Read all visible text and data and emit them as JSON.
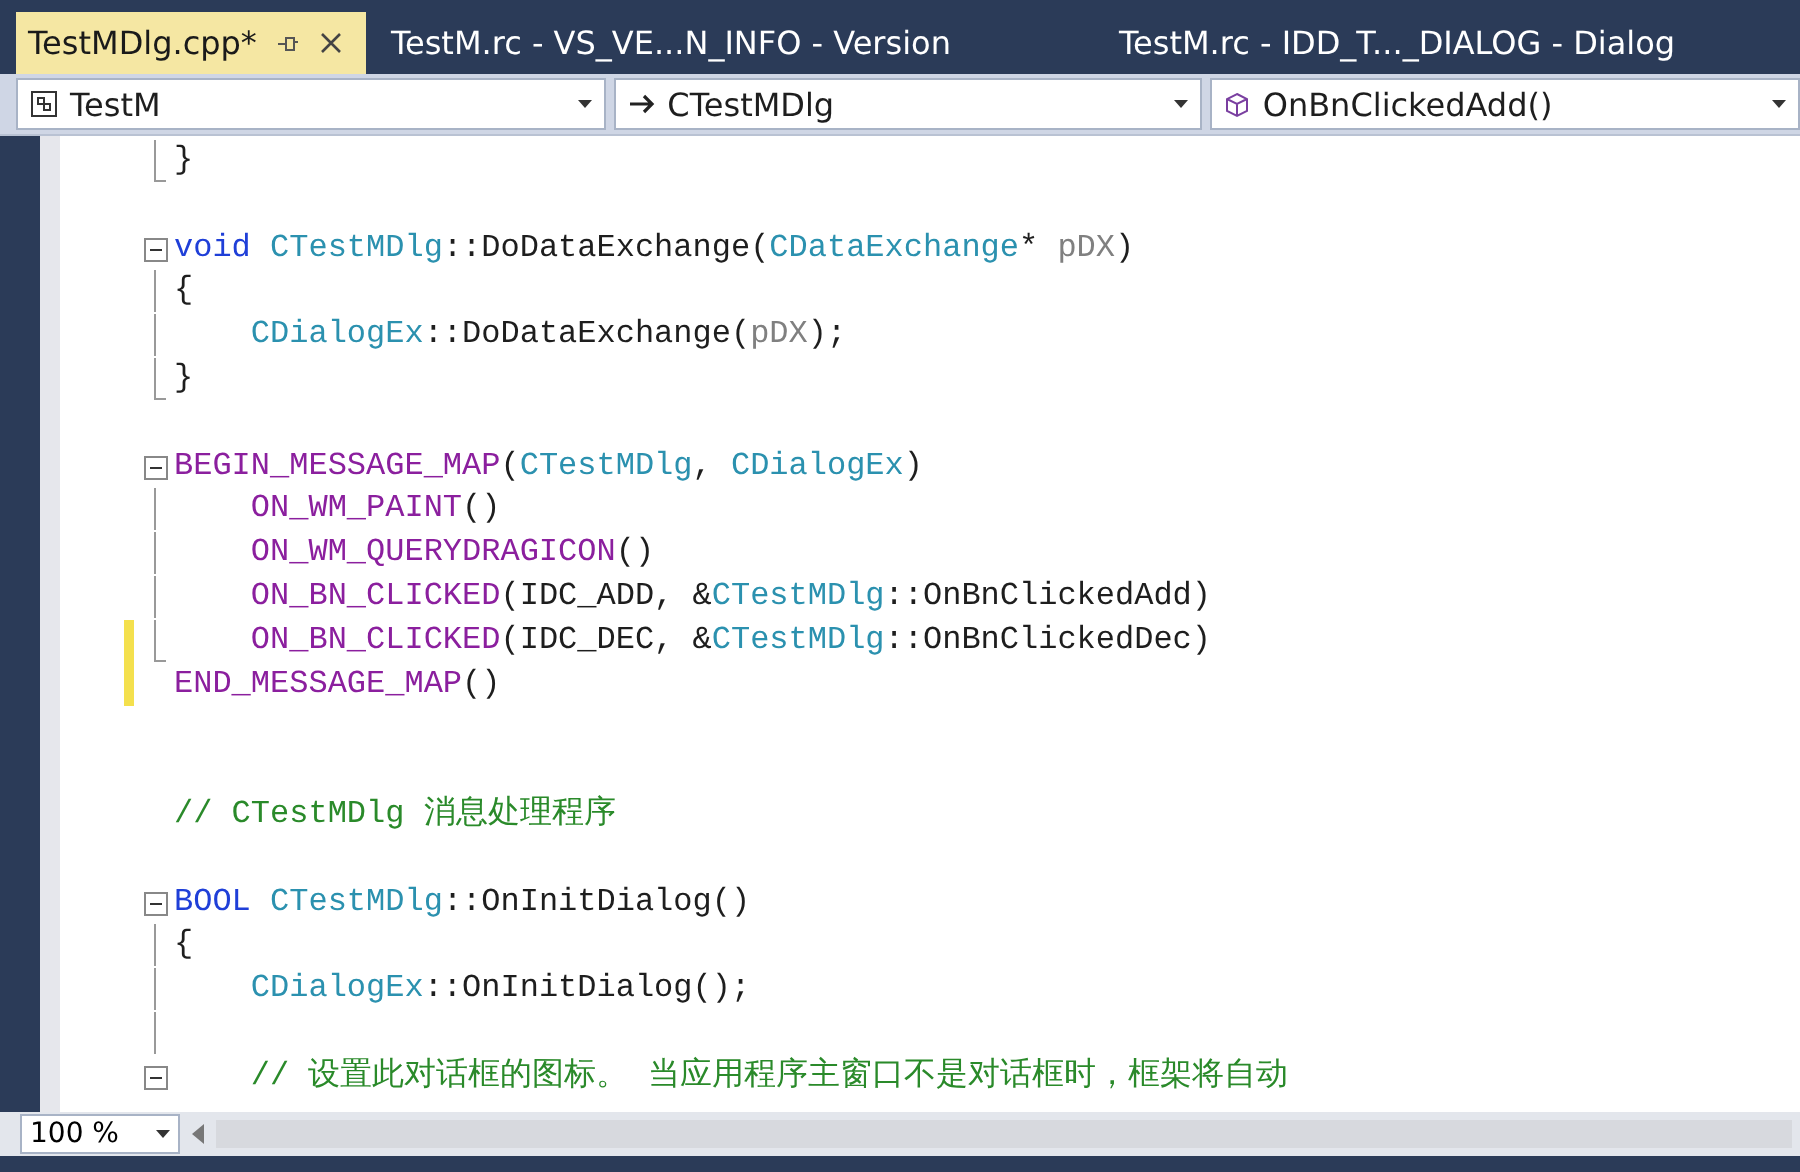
{
  "tabs": [
    {
      "label": "TestMDlg.cpp*",
      "selected": true
    },
    {
      "label": "TestM.rc - VS_VE...N_INFO - Version",
      "selected": false
    },
    {
      "label": "TestM.rc - IDD_T..._DIALOG - Dialog",
      "selected": false
    }
  ],
  "nav_bar": [
    {
      "kind": "project",
      "label": "TestM"
    },
    {
      "kind": "class",
      "label": "CTestMDlg"
    },
    {
      "kind": "member",
      "label": "OnBnClickedAdd()"
    }
  ],
  "code_lines": [
    {
      "kind": "end",
      "changed": false,
      "tokens": [
        {
          "t": "}",
          "color": "#1e1e1e"
        }
      ]
    },
    {
      "kind": "blank",
      "changed": false
    },
    {
      "kind": "open",
      "changed": false,
      "tokens": [
        {
          "t": "void ",
          "color": "#1f3fd8"
        },
        {
          "t": "CTestMDlg",
          "color": "#2b91af"
        },
        {
          "t": "::DoDataExchange(",
          "color": "#1e1e1e"
        },
        {
          "t": "CDataExchange",
          "color": "#2b91af"
        },
        {
          "t": "* ",
          "color": "#1e1e1e"
        },
        {
          "t": "pDX",
          "color": "#808080"
        },
        {
          "t": ")",
          "color": "#1e1e1e"
        }
      ]
    },
    {
      "kind": "body",
      "changed": false,
      "tokens": [
        {
          "t": "{",
          "color": "#1e1e1e"
        }
      ]
    },
    {
      "kind": "body",
      "changed": false,
      "tokens": [
        {
          "t": "    CDialogEx",
          "color": "#2b91af"
        },
        {
          "t": "::DoDataExchange(",
          "color": "#1e1e1e"
        },
        {
          "t": "pDX",
          "color": "#808080"
        },
        {
          "t": ");",
          "color": "#1e1e1e"
        }
      ]
    },
    {
      "kind": "end",
      "changed": false,
      "tokens": [
        {
          "t": "}",
          "color": "#1e1e1e"
        }
      ]
    },
    {
      "kind": "blank",
      "changed": false
    },
    {
      "kind": "open",
      "changed": false,
      "tokens": [
        {
          "t": "BEGIN_MESSAGE_MAP",
          "color": "#8b1f9e"
        },
        {
          "t": "(",
          "color": "#1e1e1e"
        },
        {
          "t": "CTestMDlg",
          "color": "#2b91af"
        },
        {
          "t": ", ",
          "color": "#1e1e1e"
        },
        {
          "t": "CDialogEx",
          "color": "#2b91af"
        },
        {
          "t": ")",
          "color": "#1e1e1e"
        }
      ]
    },
    {
      "kind": "body",
      "changed": false,
      "tokens": [
        {
          "t": "    ON_WM_PAINT",
          "color": "#8b1f9e"
        },
        {
          "t": "()",
          "color": "#1e1e1e"
        }
      ]
    },
    {
      "kind": "body",
      "changed": false,
      "tokens": [
        {
          "t": "    ON_WM_QUERYDRAGICON",
          "color": "#8b1f9e"
        },
        {
          "t": "()",
          "color": "#1e1e1e"
        }
      ]
    },
    {
      "kind": "body",
      "changed": false,
      "tokens": [
        {
          "t": "    ON_BN_CLICKED",
          "color": "#8b1f9e"
        },
        {
          "t": "(IDC_ADD, &",
          "color": "#1e1e1e"
        },
        {
          "t": "CTestMDlg",
          "color": "#2b91af"
        },
        {
          "t": "::OnBnClickedAdd)",
          "color": "#1e1e1e"
        }
      ]
    },
    {
      "kind": "end",
      "changed": true,
      "tokens": [
        {
          "t": "    ON_BN_CLICKED",
          "color": "#8b1f9e"
        },
        {
          "t": "(IDC_DEC, &",
          "color": "#1e1e1e"
        },
        {
          "t": "CTestMDlg",
          "color": "#2b91af"
        },
        {
          "t": "::OnBnClickedDec)",
          "color": "#1e1e1e"
        }
      ]
    },
    {
      "kind": "plain",
      "changed": true,
      "tokens": [
        {
          "t": "END_MESSAGE_MAP",
          "color": "#8b1f9e"
        },
        {
          "t": "()",
          "color": "#1e1e1e"
        }
      ]
    },
    {
      "kind": "blank",
      "changed": false
    },
    {
      "kind": "blank",
      "changed": false
    },
    {
      "kind": "plain",
      "changed": false,
      "tokens": [
        {
          "t": "// CTestMDlg 消息处理程序",
          "color": "#2a8a2a"
        }
      ]
    },
    {
      "kind": "blank",
      "changed": false
    },
    {
      "kind": "open",
      "changed": false,
      "tokens": [
        {
          "t": "BOOL ",
          "color": "#1f3fd8"
        },
        {
          "t": "CTestMDlg",
          "color": "#2b91af"
        },
        {
          "t": "::OnInitDialog()",
          "color": "#1e1e1e"
        }
      ]
    },
    {
      "kind": "body",
      "changed": false,
      "tokens": [
        {
          "t": "{",
          "color": "#1e1e1e"
        }
      ]
    },
    {
      "kind": "body",
      "changed": false,
      "tokens": [
        {
          "t": "    CDialogEx",
          "color": "#2b91af"
        },
        {
          "t": "::OnInitDialog();",
          "color": "#1e1e1e"
        }
      ]
    },
    {
      "kind": "body",
      "changed": false
    },
    {
      "kind": "open",
      "changed": false,
      "tokens": [
        {
          "t": "    // 设置此对话框的图标。 当应用程序主窗口不是对话框时，框架将自动",
          "color": "#2a8a2a"
        }
      ]
    }
  ],
  "zoom": {
    "value": "100 %"
  }
}
